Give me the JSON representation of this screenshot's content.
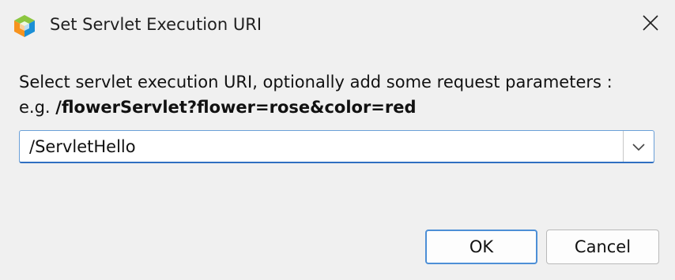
{
  "window": {
    "title": "Set Servlet Execution URI",
    "app_icon": "netbeans-cube-icon",
    "close_icon": "close-icon"
  },
  "content": {
    "instruction": "Select servlet execution URI, optionally add some request parameters :",
    "example_prefix": "e.g. ",
    "example_value": "/flowerServlet?flower=rose&color=red"
  },
  "uri_combo": {
    "value": "/ServletHello",
    "dropdown_icon": "chevron-down-icon"
  },
  "buttons": {
    "ok_label": "OK",
    "cancel_label": "Cancel"
  },
  "colors": {
    "background": "#f0f0f0",
    "accent": "#2f6fc1",
    "icon_orange": "#f7931e",
    "icon_blue": "#1b8fd6",
    "icon_green": "#8cc63f"
  }
}
